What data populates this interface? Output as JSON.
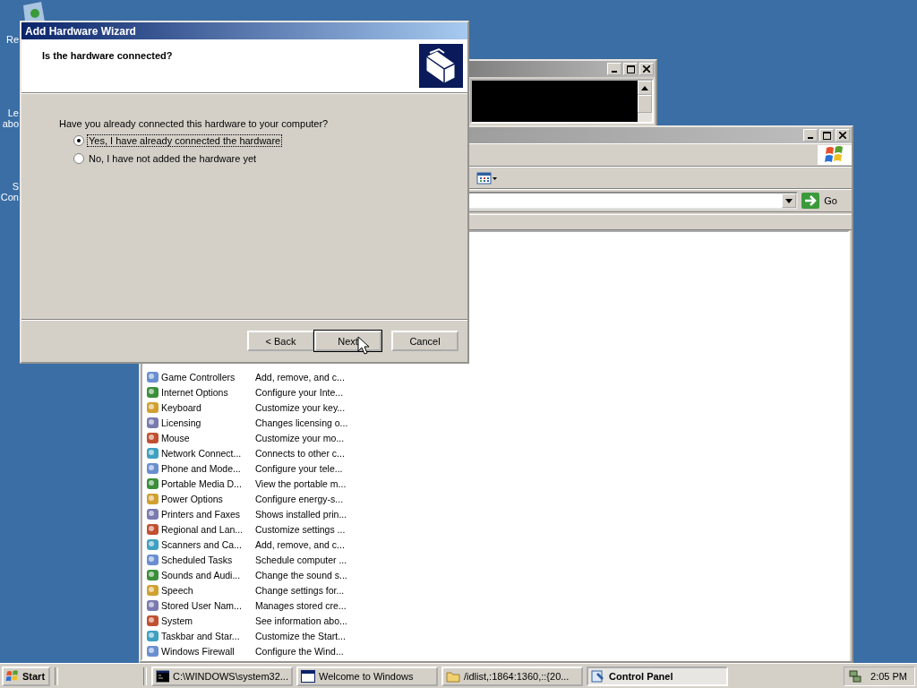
{
  "desktop_icons": [
    {
      "lines": [
        "Re"
      ]
    },
    {
      "lines": [
        "Le",
        "abo"
      ]
    },
    {
      "lines": [
        "S",
        "Con"
      ]
    }
  ],
  "console_window": {
    "active": false
  },
  "control_panel": {
    "active": false,
    "go_button": "Go",
    "items": [
      {
        "name": "Game Controllers",
        "description": "Add, remove, and c..."
      },
      {
        "name": "Internet Options",
        "description": "Configure your Inte..."
      },
      {
        "name": "Keyboard",
        "description": "Customize your key..."
      },
      {
        "name": "Licensing",
        "description": "Changes licensing o..."
      },
      {
        "name": "Mouse",
        "description": "Customize your mo..."
      },
      {
        "name": "Network Connect...",
        "description": "Connects to other c..."
      },
      {
        "name": "Phone and Mode...",
        "description": "Configure your tele..."
      },
      {
        "name": "Portable Media D...",
        "description": "View the portable m..."
      },
      {
        "name": "Power Options",
        "description": "Configure energy-s..."
      },
      {
        "name": "Printers and Faxes",
        "description": "Shows installed prin..."
      },
      {
        "name": "Regional and Lan...",
        "description": "Customize settings ..."
      },
      {
        "name": "Scanners and Ca...",
        "description": "Add, remove, and c..."
      },
      {
        "name": "Scheduled Tasks",
        "description": "Schedule computer ..."
      },
      {
        "name": "Sounds and Audi...",
        "description": "Change the sound s..."
      },
      {
        "name": "Speech",
        "description": "Change settings for..."
      },
      {
        "name": "Stored User Nam...",
        "description": "Manages stored cre..."
      },
      {
        "name": "System",
        "description": "See information abo..."
      },
      {
        "name": "Taskbar and Star...",
        "description": "Customize the Start..."
      },
      {
        "name": "Windows Firewall",
        "description": "Configure the Wind..."
      }
    ]
  },
  "wizard": {
    "title": "Add Hardware Wizard",
    "active": true,
    "heading": "Is the hardware connected?",
    "question": "Have you already connected this hardware to your computer?",
    "options": [
      {
        "label": "Yes, I have already connected the hardware",
        "selected": true
      },
      {
        "label": "No, I have not added the hardware yet",
        "selected": false
      }
    ],
    "buttons": [
      {
        "label": "< Back",
        "kind": "back",
        "default": false
      },
      {
        "label": "Next",
        "kind": "next",
        "default": true
      },
      {
        "label": "Cancel",
        "kind": "cancel",
        "default": false
      }
    ]
  },
  "taskbar": {
    "start": "Start",
    "tasks": [
      {
        "label": "C:\\WINDOWS\\system32...",
        "kind": "console",
        "selected": false
      },
      {
        "label": "Welcome to Windows",
        "kind": "window",
        "selected": false
      },
      {
        "label": "/idlist,:1864:1360,::{20...",
        "kind": "folder",
        "selected": false
      },
      {
        "label": "Control Panel",
        "kind": "control",
        "selected": true
      }
    ],
    "clock": "2:05 PM"
  }
}
